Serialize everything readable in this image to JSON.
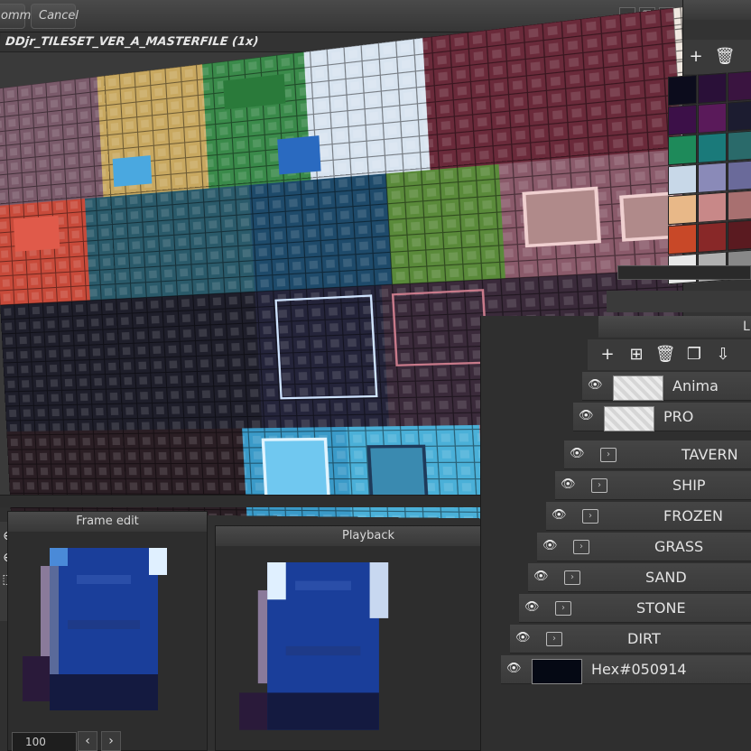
{
  "toolbar": {
    "commit_label": "ommit",
    "cancel_label": "Cancel",
    "window_buttons": [
      "_",
      "❐",
      "✕"
    ]
  },
  "document": {
    "title": "DDjr_TILESET_VER_A_MASTERFILE  (1x)"
  },
  "frame_edit": {
    "title": "Frame edit",
    "zoom_value": "100"
  },
  "playback": {
    "title": "Playback"
  },
  "palette": {
    "swatches": [
      "#0c0c1c",
      "#2a1038",
      "#3a1440",
      "#3c1048",
      "#5a1a5a",
      "#1c1c30",
      "#1e8a5a",
      "#1a7a7a",
      "#2a6a6a",
      "#c8d8e8",
      "#8a8ab8",
      "#6a6a9a",
      "#e8b888",
      "#c88888",
      "#a87070",
      "#c84828",
      "#882828",
      "#5a1a20",
      "#e8e8e8",
      "#b0b0b0",
      "#888888"
    ]
  },
  "layers": {
    "header_label": "L",
    "items": [
      {
        "name": "Anima",
        "kind": "image"
      },
      {
        "name": "PRO",
        "kind": "image"
      },
      {
        "name": "TAVERN",
        "kind": "folder"
      },
      {
        "name": "SHIP",
        "kind": "folder"
      },
      {
        "name": "FROZEN",
        "kind": "folder"
      },
      {
        "name": "GRASS",
        "kind": "folder"
      },
      {
        "name": "SAND",
        "kind": "folder"
      },
      {
        "name": "STONE",
        "kind": "folder"
      },
      {
        "name": "DIRT",
        "kind": "folder"
      },
      {
        "name": "Hex#050914",
        "kind": "color"
      }
    ]
  },
  "colors": {
    "accent": "#4a4a4a",
    "background": "#303030"
  }
}
